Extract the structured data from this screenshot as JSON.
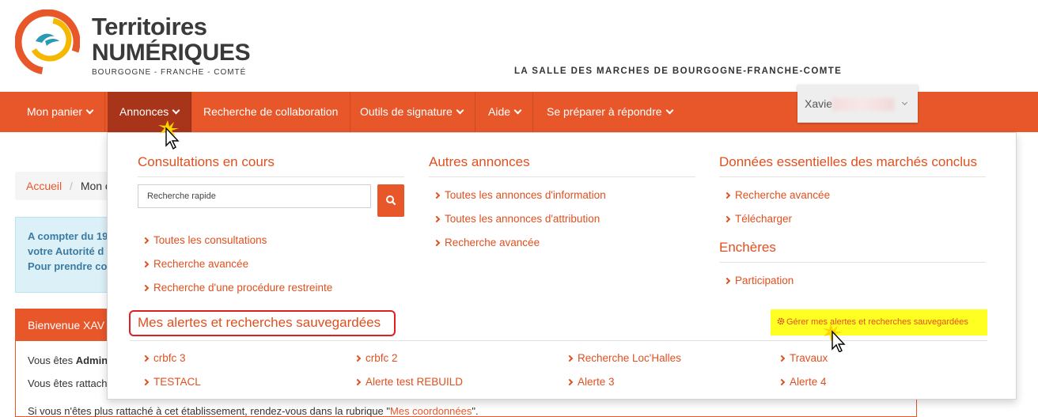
{
  "brand": {
    "line1": "Territoires",
    "line2": "NUMÉRIQUES",
    "line3": "BOURGOGNE - FRANCHE - COMTÉ",
    "tagline": "LA SALLE DES MARCHES DE BOURGOGNE-FRANCHE-COMTE",
    "colors": {
      "orange": "#e8572a",
      "dark_orange": "#a8351a",
      "yellow": "#f5b700",
      "teal": "#2a9bb5"
    }
  },
  "nav": {
    "items": [
      {
        "label": "Mon panier",
        "has_chevron": true
      },
      {
        "label": "Annonces",
        "has_chevron": true,
        "active": true
      },
      {
        "label": "Recherche de collaboration",
        "has_chevron": false
      },
      {
        "label": "Outils de signature",
        "has_chevron": true
      },
      {
        "label": "Aide",
        "has_chevron": true
      },
      {
        "label": "Se préparer à répondre",
        "has_chevron": true
      }
    ],
    "user_label": "Xavie"
  },
  "background": {
    "breadcrumb_home": "Accueil",
    "breadcrumb_sep": "/",
    "breadcrumb_current": "Mon c",
    "info_lines": [
      "A compter du 19",
      "votre Autorité d",
      "Pour prendre co"
    ],
    "welcome_title": "Bienvenue XAV",
    "welcome_line1_prefix": "Vous êtes ",
    "welcome_line1_bold": "Admin",
    "welcome_line2": "Vous êtes rattach",
    "welcome_line3_prefix": "Si vous n'êtes plus rattaché à cet établissement, rendez-vous dans la rubrique \"",
    "welcome_line3_link": "Mes coordonnées",
    "welcome_line3_suffix": "\"."
  },
  "mega_menu": {
    "col1": {
      "title": "Consultations en cours",
      "search_placeholder": "Recherche rapide",
      "links": [
        "Toutes les consultations",
        "Recherche avancée",
        "Recherche d'une procédure restreinte"
      ]
    },
    "col2": {
      "title": "Autres annonces",
      "links": [
        "Toutes les annonces d'information",
        "Toutes les annonces d'attribution",
        "Recherche avancée"
      ]
    },
    "col3": {
      "title": "Données essentielles des marchés conclus",
      "links": [
        "Recherche avancée",
        "Télécharger"
      ],
      "title2": "Enchères",
      "links2": [
        "Participation"
      ]
    },
    "alerts": {
      "title": "Mes alertes et recherches sauvegardées",
      "manage_label": "Gérer mes alertes et recherches sauvegardées",
      "items": [
        "crbfc 3",
        "crbfc 2",
        "Recherche Loc'Halles",
        "Travaux",
        "TESTACL",
        "Alerte test REBUILD",
        "Alerte 3",
        "Alerte 4"
      ]
    }
  }
}
